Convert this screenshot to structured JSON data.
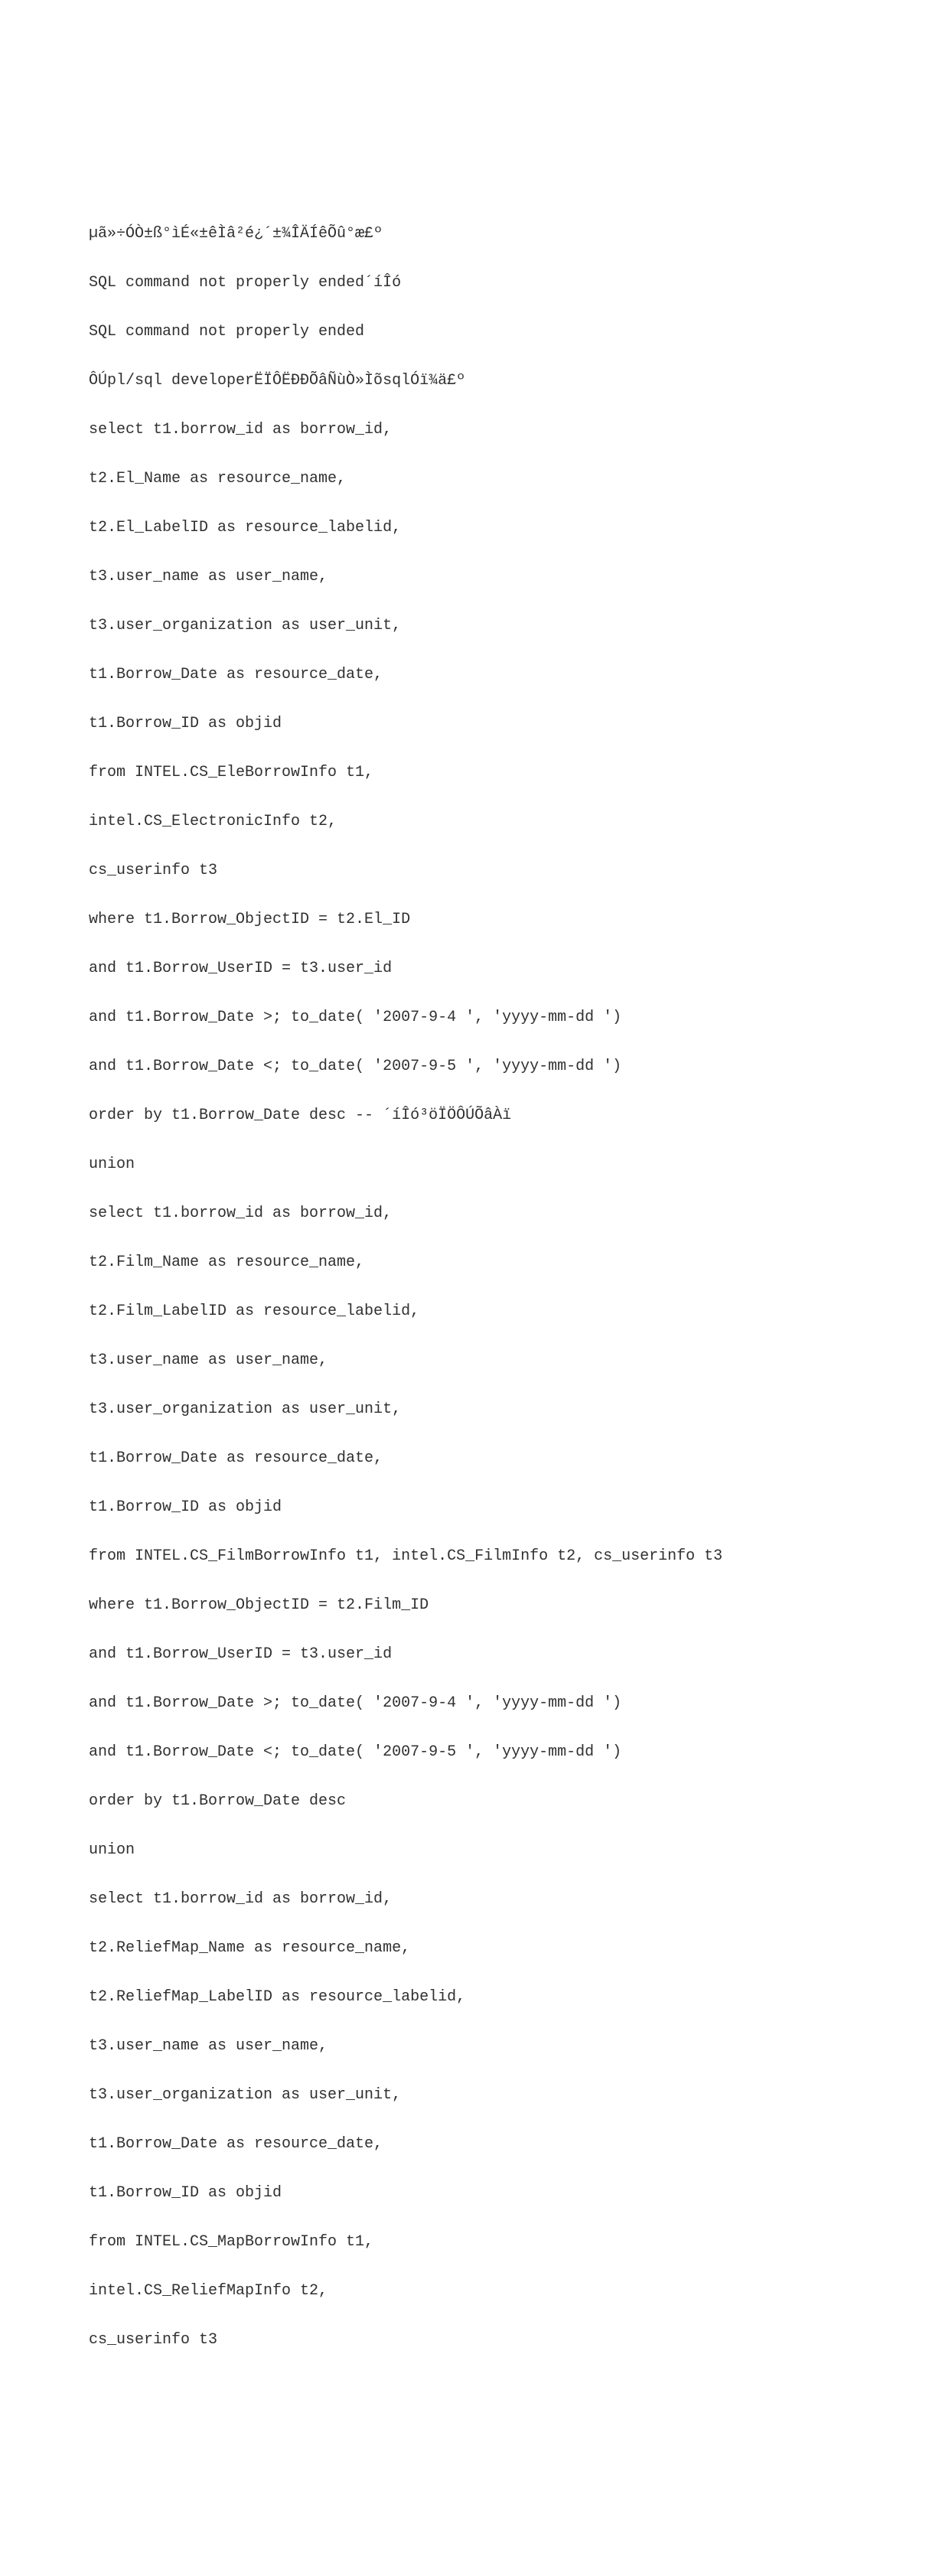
{
  "lines": [
    "µã»÷ÓÒ±ß°ìÉ«±êÌâ²é¿´±¾ÎÄÍêÕû°æ£º",
    "SQL command not properly ended´íÎó",
    "SQL command not properly ended",
    "ÔÚpl/sql developerËÏÔËÐÐÕâÑùÒ»ÌõsqlÓï¾ä£º",
    "select t1.borrow_id as borrow_id,",
    "t2.El_Name as resource_name,",
    "t2.El_LabelID as resource_labelid,",
    "t3.user_name as user_name,",
    "t3.user_organization as user_unit,",
    "t1.Borrow_Date as resource_date,",
    "t1.Borrow_ID as objid",
    "from INTEL.CS_EleBorrowInfo t1,",
    "intel.CS_ElectronicInfo t2,",
    "cs_userinfo t3",
    "where t1.Borrow_ObjectID = t2.El_ID",
    "and t1.Borrow_UserID = t3.user_id",
    "and t1.Borrow_Date >; to_date( '2007-9-4 ', 'yyyy-mm-dd ')",
    "and t1.Borrow_Date <; to_date( '2007-9-5 ', 'yyyy-mm-dd ')",
    "order by t1.Borrow_Date desc -- ´íÎó³öÏÖÔÚÕâÀï",
    "union",
    "select t1.borrow_id as borrow_id,",
    "t2.Film_Name as resource_name,",
    "t2.Film_LabelID as resource_labelid,",
    "t3.user_name as user_name,",
    "t3.user_organization as user_unit,",
    "t1.Borrow_Date as resource_date,",
    "t1.Borrow_ID as objid",
    "from INTEL.CS_FilmBorrowInfo t1, intel.CS_FilmInfo t2, cs_userinfo t3",
    "where t1.Borrow_ObjectID = t2.Film_ID",
    "and t1.Borrow_UserID = t3.user_id",
    "and t1.Borrow_Date >; to_date( '2007-9-4 ', 'yyyy-mm-dd ')",
    "and t1.Borrow_Date <; to_date( '2007-9-5 ', 'yyyy-mm-dd ')",
    "order by t1.Borrow_Date desc",
    "union",
    "select t1.borrow_id as borrow_id,",
    "t2.ReliefMap_Name as resource_name,",
    "t2.ReliefMap_LabelID as resource_labelid,",
    "t3.user_name as user_name,",
    "t3.user_organization as user_unit,",
    "t1.Borrow_Date as resource_date,",
    "t1.Borrow_ID as objid",
    "from INTEL.CS_MapBorrowInfo t1,",
    "intel.CS_ReliefMapInfo t2,",
    "cs_userinfo t3"
  ]
}
